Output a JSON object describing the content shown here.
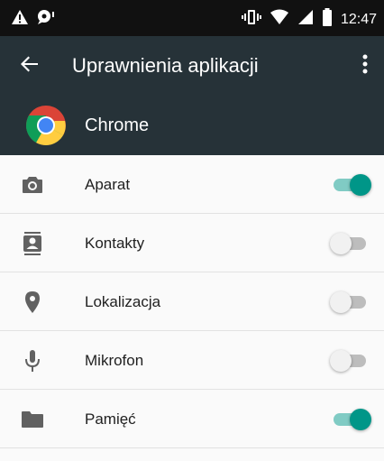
{
  "status_bar": {
    "time": "12:47",
    "icons": [
      "warning-icon",
      "notification-icon",
      "vibrate-icon",
      "wifi-icon",
      "signal-icon",
      "battery-icon"
    ]
  },
  "toolbar": {
    "title": "Uprawnienia aplikacji",
    "back_icon": "arrow-back-icon",
    "menu_icon": "more-vert-icon"
  },
  "app": {
    "name": "Chrome",
    "logo_icon": "chrome-logo-icon"
  },
  "permissions": [
    {
      "label": "Aparat",
      "icon": "camera-icon",
      "enabled": true
    },
    {
      "label": "Kontakty",
      "icon": "contacts-icon",
      "enabled": false
    },
    {
      "label": "Lokalizacja",
      "icon": "location-icon",
      "enabled": false
    },
    {
      "label": "Mikrofon",
      "icon": "microphone-icon",
      "enabled": false
    },
    {
      "label": "Pamięć",
      "icon": "folder-icon",
      "enabled": true
    }
  ],
  "colors": {
    "toolbar": "#263238",
    "status_bar": "#111111",
    "toggle_on_thumb": "#009688",
    "toggle_on_track": "#80cbc4",
    "toggle_off_thumb": "#f1f1f1",
    "toggle_off_track": "#bdbdbd",
    "icon": "#616161"
  }
}
